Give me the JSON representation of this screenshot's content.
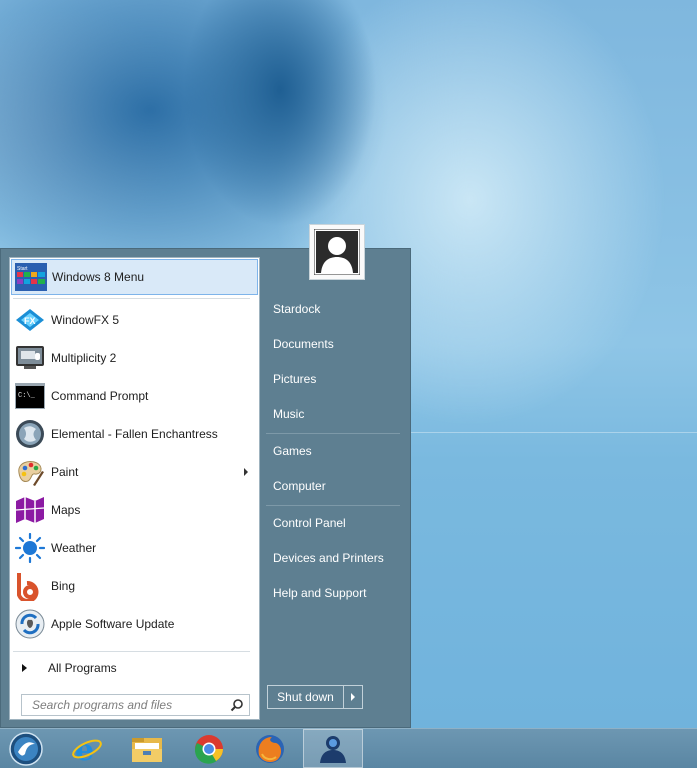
{
  "start_menu": {
    "programs": [
      {
        "label": "Windows 8 Menu",
        "icon": "windows8-menu-icon",
        "selected": true
      },
      {
        "label": "WindowFX 5",
        "icon": "windowfx-icon"
      },
      {
        "label": "Multiplicity 2",
        "icon": "multiplicity-icon"
      },
      {
        "label": "Command Prompt",
        "icon": "command-prompt-icon"
      },
      {
        "label": "Elemental - Fallen Enchantress",
        "icon": "elemental-icon"
      },
      {
        "label": "Paint",
        "icon": "paint-icon",
        "has_submenu": true
      },
      {
        "label": "Maps",
        "icon": "maps-icon"
      },
      {
        "label": "Weather",
        "icon": "weather-icon"
      },
      {
        "label": "Bing",
        "icon": "bing-icon"
      },
      {
        "label": "Apple Software Update",
        "icon": "apple-software-update-icon"
      }
    ],
    "all_programs": "All Programs",
    "search_placeholder": "Search programs and files",
    "right_items": [
      "Stardock",
      "Documents",
      "Pictures",
      "Music",
      "Games",
      "Computer",
      "Control Panel",
      "Devices and Printers",
      "Help and Support"
    ],
    "shutdown_label": "Shut down",
    "command_prompt_icon_text": "C:\\_"
  },
  "taskbar": {
    "items": [
      "start-orb-icon",
      "internet-explorer-icon",
      "file-explorer-icon",
      "chrome-icon",
      "firefox-icon",
      "user-app-icon"
    ],
    "active_item": "user-app-icon"
  },
  "colors": {
    "menu_right_bg": "#5e7f91",
    "selection_bg": "#d9e9f8",
    "selection_border": "#7eb4ea",
    "taskbar_bg": "#6d97b2"
  }
}
